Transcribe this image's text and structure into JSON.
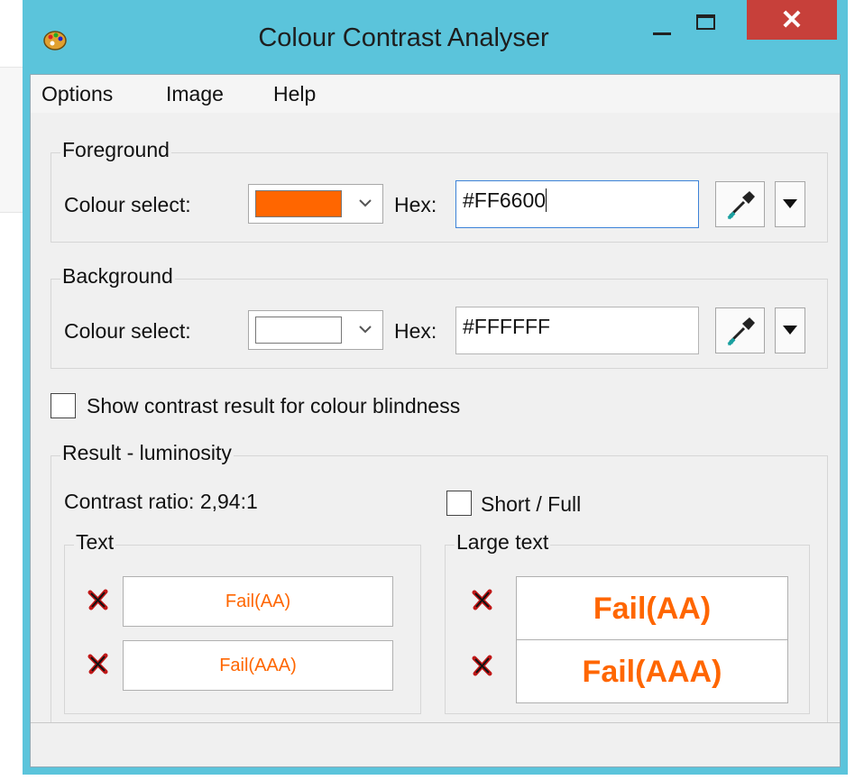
{
  "window": {
    "title": "Colour Contrast Analyser",
    "close_glyph": "✕"
  },
  "menu": [
    "Options",
    "Image",
    "Help"
  ],
  "foreground": {
    "legend": "Foreground",
    "colour_select_label": "Colour select:",
    "swatch_color": "#FF6600",
    "hex_label": "Hex:",
    "hex_value": "#FF6600"
  },
  "background": {
    "legend": "Background",
    "colour_select_label": "Colour select:",
    "swatch_color": "#FFFFFF",
    "hex_label": "Hex:",
    "hex_value": "#FFFFFF"
  },
  "colour_blindness_label": "Show contrast result for colour blindness",
  "result": {
    "legend": "Result - luminosity",
    "contrast_ratio": "Contrast ratio: 2,94:1",
    "short_full_label": "Short / Full",
    "text_group": {
      "legend": "Text",
      "aa": "Fail(AA)",
      "aaa": "Fail(AAA)"
    },
    "large_text_group": {
      "legend": "Large text",
      "aa": "Fail(AA)",
      "aaa": "Fail(AAA)"
    }
  },
  "colors": {
    "titlebar": "#5BC4DB",
    "close_button": "#C7403A",
    "result_text": "#FF6600",
    "fail_icon": "#C01818"
  },
  "icons": {
    "app": "palette-icon",
    "picker": "eyedropper-icon",
    "fail": "cross-icon"
  }
}
